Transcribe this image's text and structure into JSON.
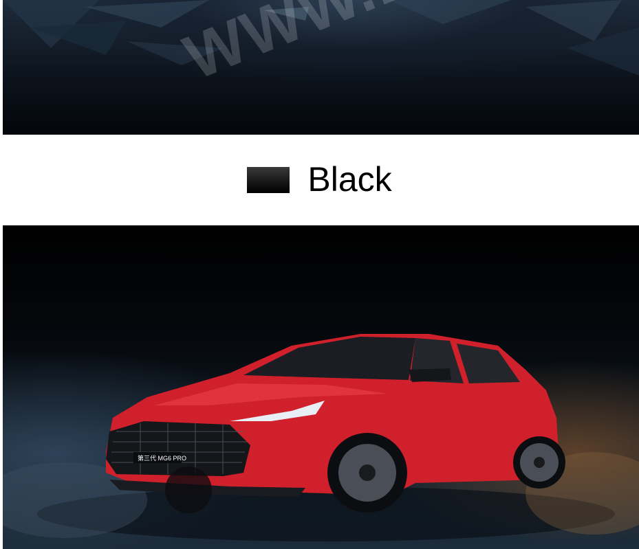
{
  "top_image": {
    "description_icon": "dark-abstract-background",
    "watermark_text": "WWW.BORDE"
  },
  "color_option": {
    "swatch_color": "#1a1a1a",
    "label": "Black"
  },
  "car_image": {
    "icon": "red-sedan-photo",
    "body_color": "#d8222c",
    "badge_text": "第三代 MG6 PRO"
  }
}
